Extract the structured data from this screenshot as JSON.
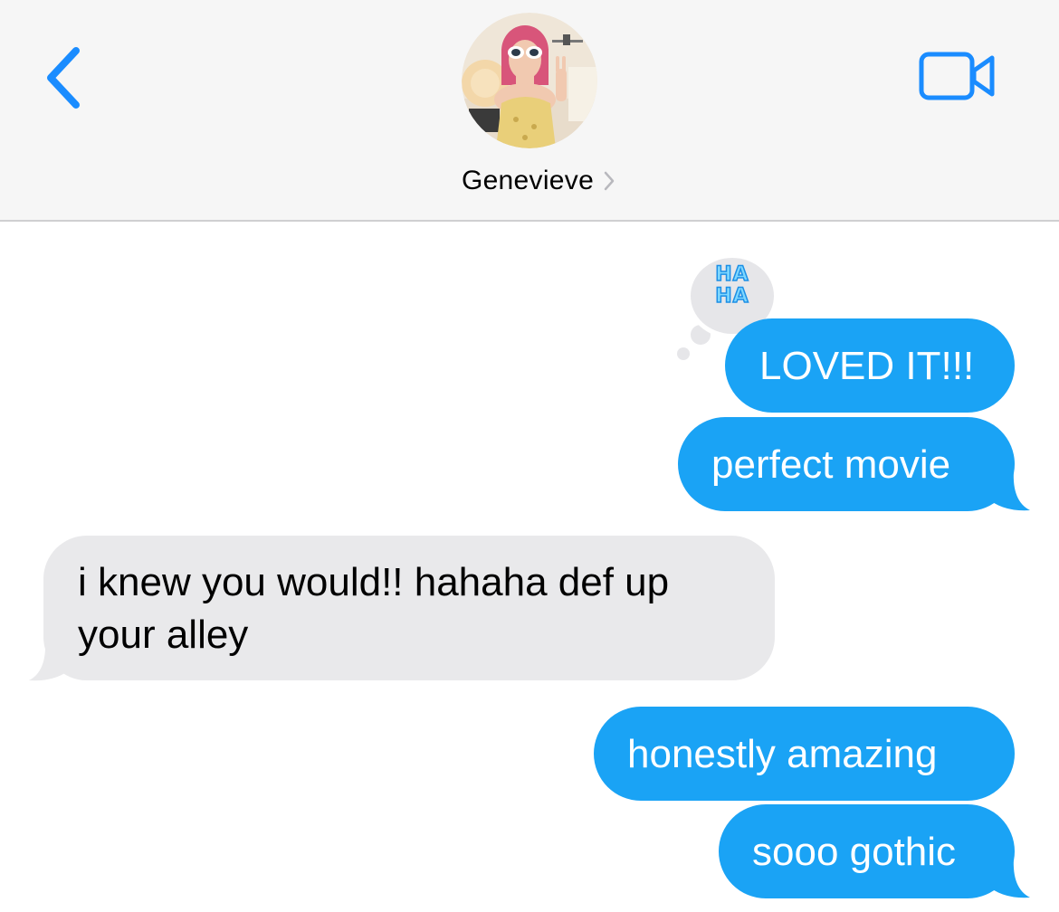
{
  "header": {
    "contact_name": "Genevieve"
  },
  "icons": {
    "back": "chevron-left-icon",
    "video": "video-camera-icon",
    "disclosure": "chevron-right-icon"
  },
  "tapback": {
    "label_line1": "HA",
    "label_line2": "HA"
  },
  "messages": [
    {
      "direction": "sent",
      "text": "LOVED IT!!!"
    },
    {
      "direction": "sent",
      "text": "perfect movie"
    },
    {
      "direction": "received",
      "text_line1": "i knew you would!! hahaha def up",
      "text_line2": "your alley"
    },
    {
      "direction": "sent",
      "text": "honestly amazing"
    },
    {
      "direction": "sent",
      "text": "sooo gothic"
    }
  ],
  "colors": {
    "accent": "#1a8cff",
    "sent_bubble": "#1aa3f5",
    "received_bubble": "#e9e9eb",
    "header_bg": "#f6f6f6"
  }
}
